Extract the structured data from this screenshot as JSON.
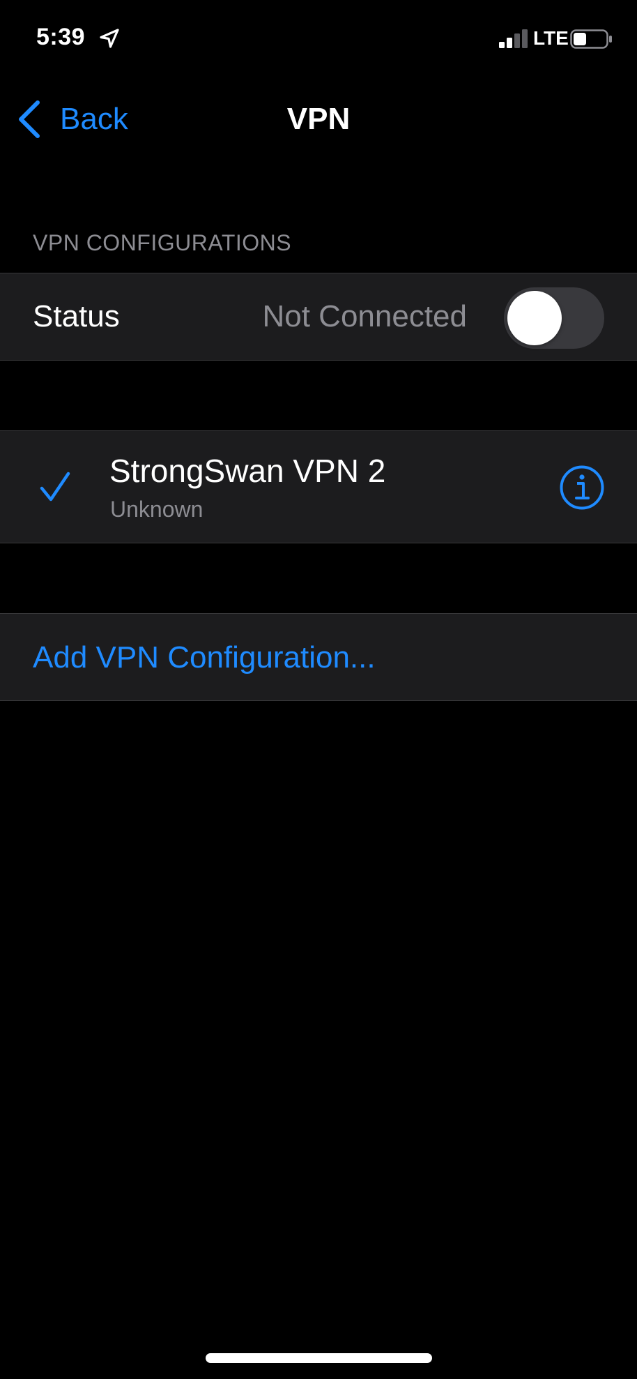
{
  "status_bar": {
    "time": "5:39",
    "network": "LTE",
    "signal_bars_active": 2,
    "signal_bars_total": 4,
    "battery_level": 0.4,
    "icons": {
      "location": "location-arrow-icon",
      "signal": "cellular-signal-icon",
      "battery": "battery-icon"
    }
  },
  "nav": {
    "back_label": "Back",
    "title": "VPN"
  },
  "section": {
    "header": "VPN CONFIGURATIONS"
  },
  "status_row": {
    "label": "Status",
    "value": "Not Connected",
    "toggle_on": false
  },
  "configurations": [
    {
      "name": "StrongSwan VPN 2",
      "status": "Unknown",
      "selected": true
    }
  ],
  "add_configuration": {
    "label": "Add VPN Configuration..."
  },
  "colors": {
    "background": "#000000",
    "cell": "#1c1c1e",
    "separator": "#38383a",
    "accent": "#1f8bff",
    "secondary_text": "#8d8d93",
    "toggle_off": "#39393d"
  }
}
